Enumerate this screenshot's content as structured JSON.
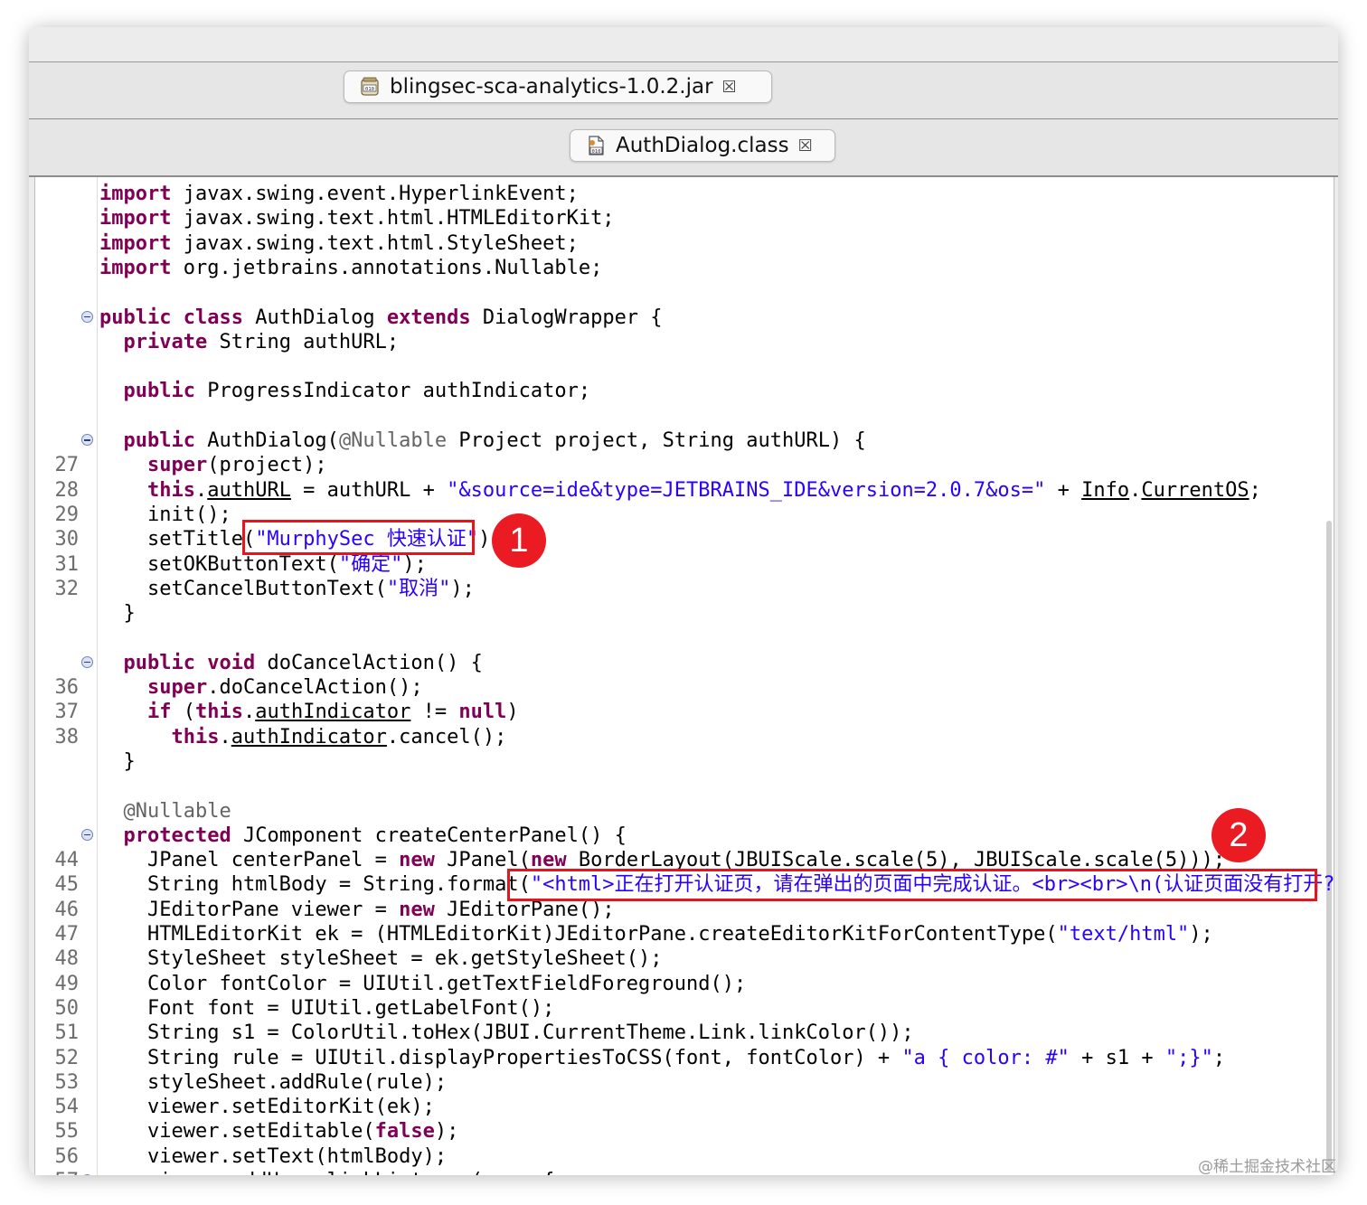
{
  "tabs": {
    "jar": {
      "label": "blingsec-sca-analytics-1.0.2.jar",
      "icon": "jar-file-icon"
    },
    "class": {
      "label": "AuthDialog.class",
      "icon": "class-file-icon"
    },
    "close_glyph": "☒"
  },
  "annotations": {
    "badge1": "1",
    "badge2": "2",
    "accent": "#ea1b23"
  },
  "watermark": "@稀土掘金技术社区",
  "code_lines": [
    {
      "n": "",
      "fold": false,
      "t": [
        [
          "kw",
          "import"
        ],
        [
          "p",
          " javax.swing.event.HyperlinkEvent;"
        ]
      ]
    },
    {
      "n": "",
      "fold": false,
      "t": [
        [
          "kw",
          "import"
        ],
        [
          "p",
          " javax.swing.text.html.HTMLEditorKit;"
        ]
      ]
    },
    {
      "n": "",
      "fold": false,
      "t": [
        [
          "kw",
          "import"
        ],
        [
          "p",
          " javax.swing.text.html.StyleSheet;"
        ]
      ]
    },
    {
      "n": "",
      "fold": false,
      "t": [
        [
          "kw",
          "import"
        ],
        [
          "p",
          " org.jetbrains.annotations.Nullable;"
        ]
      ]
    },
    null,
    {
      "n": "",
      "fold": true,
      "t": [
        [
          "kw",
          "public class"
        ],
        [
          "p",
          " AuthDialog "
        ],
        [
          "kw",
          "extends"
        ],
        [
          "p",
          " DialogWrapper {"
        ]
      ]
    },
    {
      "n": "",
      "fold": false,
      "t": [
        [
          "p",
          "  "
        ],
        [
          "kw",
          "private"
        ],
        [
          "p",
          " String authURL;"
        ]
      ]
    },
    null,
    {
      "n": "",
      "fold": false,
      "t": [
        [
          "p",
          "  "
        ],
        [
          "kw",
          "public"
        ],
        [
          "p",
          " ProgressIndicator authIndicator;"
        ]
      ]
    },
    null,
    {
      "n": "",
      "fold": true,
      "t": [
        [
          "p",
          "  "
        ],
        [
          "kw",
          "public"
        ],
        [
          "p",
          " AuthDialog("
        ],
        [
          "ann",
          "@Nullable"
        ],
        [
          "p",
          " Project project, String authURL) {"
        ]
      ]
    },
    {
      "n": "27",
      "fold": false,
      "t": [
        [
          "p",
          "    "
        ],
        [
          "kw",
          "super"
        ],
        [
          "p",
          "(project);"
        ]
      ]
    },
    {
      "n": "28",
      "fold": false,
      "t": [
        [
          "p",
          "    "
        ],
        [
          "kw",
          "this"
        ],
        [
          "p",
          "."
        ],
        [
          "fld",
          "authURL"
        ],
        [
          "p",
          " = authURL + "
        ],
        [
          "str",
          "\"&source=ide&type=JETBRAINS_IDE&version=2.0.7&os=\""
        ],
        [
          "p",
          " + "
        ],
        [
          "fld",
          "Info"
        ],
        [
          "p",
          "."
        ],
        [
          "fld",
          "CurrentOS"
        ],
        [
          "p",
          ";"
        ]
      ]
    },
    {
      "n": "29",
      "fold": false,
      "t": [
        [
          "p",
          "    init();"
        ]
      ]
    },
    {
      "n": "30",
      "fold": false,
      "t": [
        [
          "p",
          "    setTitle("
        ],
        [
          "str",
          "\"MurphySec 快速认证\""
        ],
        [
          "p",
          ");"
        ]
      ]
    },
    {
      "n": "31",
      "fold": false,
      "t": [
        [
          "p",
          "    setOKButtonText("
        ],
        [
          "str",
          "\"确定\""
        ],
        [
          "p",
          ");"
        ]
      ]
    },
    {
      "n": "32",
      "fold": false,
      "t": [
        [
          "p",
          "    setCancelButtonText("
        ],
        [
          "str",
          "\"取消\""
        ],
        [
          "p",
          ");"
        ]
      ]
    },
    {
      "n": "",
      "fold": false,
      "t": [
        [
          "p",
          "  }"
        ]
      ]
    },
    null,
    {
      "n": "",
      "fold": true,
      "t": [
        [
          "p",
          "  "
        ],
        [
          "kw",
          "public void"
        ],
        [
          "p",
          " doCancelAction() {"
        ]
      ]
    },
    {
      "n": "36",
      "fold": false,
      "t": [
        [
          "p",
          "    "
        ],
        [
          "kw",
          "super"
        ],
        [
          "p",
          ".doCancelAction();"
        ]
      ]
    },
    {
      "n": "37",
      "fold": false,
      "t": [
        [
          "p",
          "    "
        ],
        [
          "kw",
          "if"
        ],
        [
          "p",
          " ("
        ],
        [
          "kw",
          "this"
        ],
        [
          "p",
          "."
        ],
        [
          "fld",
          "authIndicator"
        ],
        [
          "p",
          " != "
        ],
        [
          "kw",
          "null"
        ],
        [
          "p",
          ")"
        ]
      ]
    },
    {
      "n": "38",
      "fold": false,
      "t": [
        [
          "p",
          "      "
        ],
        [
          "kw",
          "this"
        ],
        [
          "p",
          "."
        ],
        [
          "fld",
          "authIndicator"
        ],
        [
          "p",
          ".cancel();"
        ]
      ]
    },
    {
      "n": "",
      "fold": false,
      "t": [
        [
          "p",
          "  }"
        ]
      ]
    },
    null,
    {
      "n": "",
      "fold": false,
      "t": [
        [
          "p",
          "  "
        ],
        [
          "ann",
          "@Nullable"
        ]
      ]
    },
    {
      "n": "",
      "fold": true,
      "t": [
        [
          "p",
          "  "
        ],
        [
          "kw",
          "protected"
        ],
        [
          "p",
          " JComponent createCenterPanel() {"
        ]
      ]
    },
    {
      "n": "44",
      "fold": false,
      "t": [
        [
          "p",
          "    JPanel centerPanel = "
        ],
        [
          "kw",
          "new"
        ],
        [
          "p",
          " JPanel("
        ],
        [
          "kw",
          "new"
        ],
        [
          "p",
          " BorderLayout(JBUIScale.scale(5), JBUIScale.scale(5)));"
        ]
      ]
    },
    {
      "n": "45",
      "fold": false,
      "t": [
        [
          "p",
          "    String htmlBody = String.format("
        ],
        [
          "str",
          "\"<html>正在打开认证页，请在弹出的页面中完成认证。<br><br>\\n(认证页面没有打开? <"
        ]
      ]
    },
    {
      "n": "46",
      "fold": false,
      "t": [
        [
          "p",
          "    JEditorPane viewer = "
        ],
        [
          "kw",
          "new"
        ],
        [
          "p",
          " JEditorPane();"
        ]
      ]
    },
    {
      "n": "47",
      "fold": false,
      "t": [
        [
          "p",
          "    HTMLEditorKit ek = (HTMLEditorKit)JEditorPane.createEditorKitForContentType("
        ],
        [
          "str",
          "\"text/html\""
        ],
        [
          "p",
          ");"
        ]
      ]
    },
    {
      "n": "48",
      "fold": false,
      "t": [
        [
          "p",
          "    StyleSheet styleSheet = ek.getStyleSheet();"
        ]
      ]
    },
    {
      "n": "49",
      "fold": false,
      "t": [
        [
          "p",
          "    Color fontColor = UIUtil.getTextFieldForeground();"
        ]
      ]
    },
    {
      "n": "50",
      "fold": false,
      "t": [
        [
          "p",
          "    Font font = UIUtil.getLabelFont();"
        ]
      ]
    },
    {
      "n": "51",
      "fold": false,
      "t": [
        [
          "p",
          "    String s1 = ColorUtil.toHex(JBUI.CurrentTheme.Link.linkColor());"
        ]
      ]
    },
    {
      "n": "52",
      "fold": false,
      "t": [
        [
          "p",
          "    String rule = UIUtil.displayPropertiesToCSS(font, fontColor) + "
        ],
        [
          "str",
          "\"a { color: #\""
        ],
        [
          "p",
          " + s1 + "
        ],
        [
          "str",
          "\";}\""
        ],
        [
          "p",
          ";"
        ]
      ]
    },
    {
      "n": "53",
      "fold": false,
      "t": [
        [
          "p",
          "    styleSheet.addRule(rule);"
        ]
      ]
    },
    {
      "n": "54",
      "fold": false,
      "t": [
        [
          "p",
          "    viewer.setEditorKit(ek);"
        ]
      ]
    },
    {
      "n": "55",
      "fold": false,
      "t": [
        [
          "p",
          "    viewer.setEditable("
        ],
        [
          "kw",
          "false"
        ],
        [
          "p",
          ");"
        ]
      ]
    },
    {
      "n": "56",
      "fold": false,
      "t": [
        [
          "p",
          "    viewer.setText(htmlBody);"
        ]
      ]
    },
    {
      "n": "57",
      "fold": true,
      "t": [
        [
          "p",
          "    viewer.addHyperlinkListener(e -> {"
        ]
      ]
    }
  ]
}
